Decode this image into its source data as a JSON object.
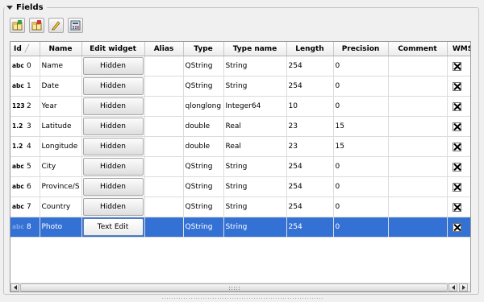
{
  "group": {
    "title": "Fields"
  },
  "toolbar": {
    "buttons": [
      {
        "icon": "new-field-icon"
      },
      {
        "icon": "delete-field-icon"
      },
      {
        "icon": "pencil-edit-icon"
      },
      {
        "icon": "field-calculator-icon"
      }
    ]
  },
  "table": {
    "columns": [
      "Id",
      "Edit widget",
      "Name",
      "Alias",
      "Type",
      "Type name",
      "Length",
      "Precision",
      "Comment",
      "WMS"
    ],
    "sorted_column": "Id",
    "rows": [
      {
        "type_icon": "abc",
        "id": "0",
        "name": "Name",
        "widget": "Hidden",
        "alias": "",
        "type": "QString",
        "type_name": "String",
        "length": "254",
        "precision": "0",
        "comment": "",
        "wms": true
      },
      {
        "type_icon": "abc",
        "id": "1",
        "name": "Date",
        "widget": "Hidden",
        "alias": "",
        "type": "QString",
        "type_name": "String",
        "length": "254",
        "precision": "0",
        "comment": "",
        "wms": true
      },
      {
        "type_icon": "123",
        "id": "2",
        "name": "Year",
        "widget": "Hidden",
        "alias": "",
        "type": "qlonglong",
        "type_name": "Integer64",
        "length": "10",
        "precision": "0",
        "comment": "",
        "wms": true
      },
      {
        "type_icon": "1.2",
        "id": "3",
        "name": "Latitude",
        "widget": "Hidden",
        "alias": "",
        "type": "double",
        "type_name": "Real",
        "length": "23",
        "precision": "15",
        "comment": "",
        "wms": true
      },
      {
        "type_icon": "1.2",
        "id": "4",
        "name": "Longitude",
        "widget": "Hidden",
        "alias": "",
        "type": "double",
        "type_name": "Real",
        "length": "23",
        "precision": "15",
        "comment": "",
        "wms": true
      },
      {
        "type_icon": "abc",
        "id": "5",
        "name": "City",
        "widget": "Hidden",
        "alias": "",
        "type": "QString",
        "type_name": "String",
        "length": "254",
        "precision": "0",
        "comment": "",
        "wms": true
      },
      {
        "type_icon": "abc",
        "id": "6",
        "name": "Province/S",
        "widget": "Hidden",
        "alias": "",
        "type": "QString",
        "type_name": "String",
        "length": "254",
        "precision": "0",
        "comment": "",
        "wms": true
      },
      {
        "type_icon": "abc",
        "id": "7",
        "name": "Country",
        "widget": "Hidden",
        "alias": "",
        "type": "QString",
        "type_name": "String",
        "length": "254",
        "precision": "0",
        "comment": "",
        "wms": true
      },
      {
        "type_icon": "abc",
        "id": "8",
        "name": "Photo",
        "widget": "Text Edit",
        "alias": "",
        "type": "QString",
        "type_name": "String",
        "length": "254",
        "precision": "0",
        "comment": "",
        "wms": true,
        "selected": true
      }
    ]
  },
  "colors": {
    "selection": "#3471d4",
    "header_bg": "#ececec"
  }
}
